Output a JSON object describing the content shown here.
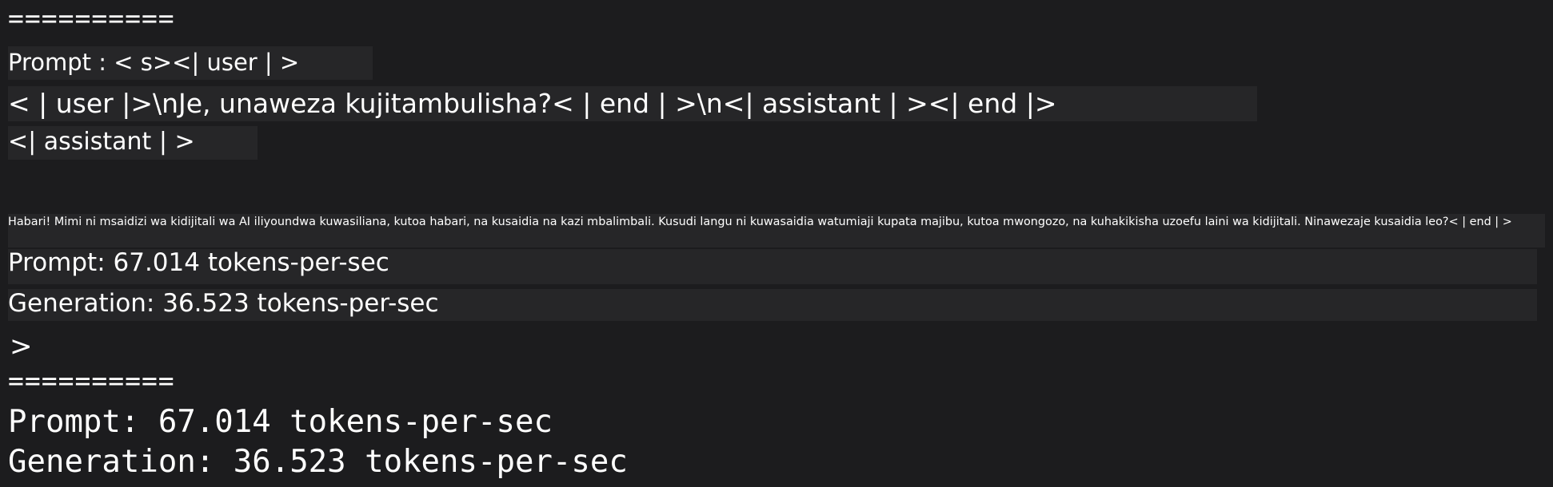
{
  "terminal": {
    "separator_top": "==========",
    "prompt_line_1": "Prompt : < s><| user | >",
    "prompt_line_2": "< | user |>\\nJe, unaweza kujitambulisha?< | end | >\\n<| assistant | ><| end |>",
    "prompt_line_3": "<| assistant | >",
    "response": "Habari! Mimi ni msaidizi wa kidijitali wa AI iliyoundwa kuwasiliana, kutoa habari, na kusaidia na kazi mbalimbali. Kusudi langu ni kuwasaidia watumiaji kupata majibu, kutoa mwongozo, na kuhakikisha uzoefu laini wa kidijitali. Ninawezaje kusaidia leo?< | end | >",
    "stats_prompt": "Prompt: 67.014 tokens-per-sec",
    "stats_generation": "Generation: 36.523 tokens-per-sec",
    "input_caret": ">",
    "separator_bottom": "==========",
    "stats_prompt_mono": "Prompt: 67.014 tokens-per-sec",
    "stats_generation_mono": "Generation: 36.523 tokens-per-sec"
  }
}
